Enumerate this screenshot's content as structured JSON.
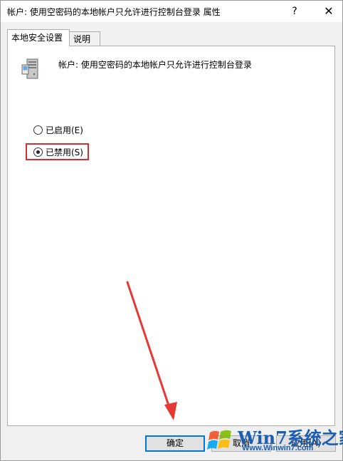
{
  "window": {
    "title": "帐户: 使用空密码的本地帐户只允许进行控制台登录 属性",
    "help_label": "?",
    "close_label": "✕"
  },
  "tabs": [
    {
      "label": "本地安全设置",
      "active": true
    },
    {
      "label": "说明",
      "active": false
    }
  ],
  "policy": {
    "icon": "server-computer-icon",
    "name": "帐户: 使用空密码的本地帐户只允许进行控制台登录"
  },
  "options": [
    {
      "label": "已启用(E)",
      "checked": false
    },
    {
      "label": "已禁用(S)",
      "checked": true
    }
  ],
  "buttons": {
    "ok": "确定",
    "cancel": "取消",
    "apply": "应用(A)"
  },
  "watermark": {
    "text": "Win7系统之家",
    "url": "Www.Winwin7.com"
  },
  "colors": {
    "highlight": "#d32f2f",
    "arrow": "#e53935",
    "focus": "#0078d7"
  }
}
